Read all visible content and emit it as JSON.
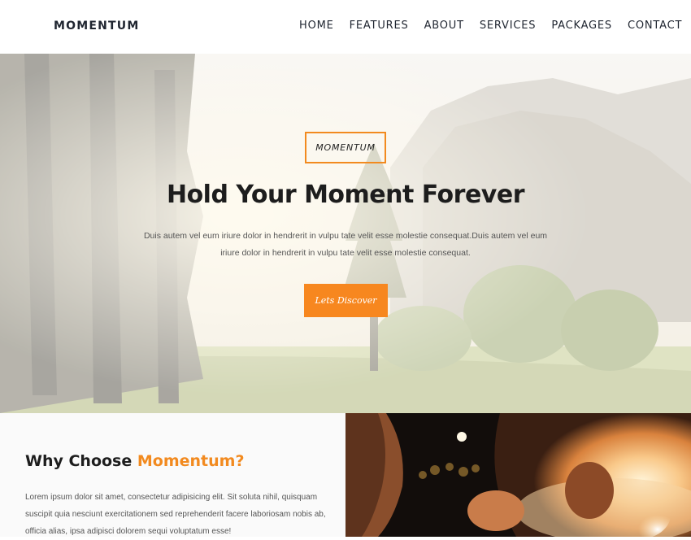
{
  "header": {
    "logo": "MOMENTUM",
    "nav": [
      "HOME",
      "FEATURES",
      "ABOUT",
      "SERVICES",
      "PACKAGES",
      "CONTACT"
    ]
  },
  "hero": {
    "badge": "MOMENTUM",
    "title": "Hold Your Moment Forever",
    "text": "Duis autem vel eum iriure dolor in hendrerit in vulpu tate velit esse molestie consequat.Duis autem vel eum iriure dolor in hendrerit in vulpu tate velit esse molestie consequat.",
    "button": "Lets Discover"
  },
  "why": {
    "title_prefix": "Why Choose ",
    "title_accent": "Momentum?",
    "text": "Lorem ipsum dolor sit amet, consectetur adipisicing elit. Sit soluta nihil, quisquam suscipit quia nesciunt exercitationem sed reprehenderit facere laboriosam nobis ab, officia alias, ipsa adipisci dolorem sequi voluptatum esse!"
  },
  "colors": {
    "accent": "#f7871f",
    "text_dark": "#1d1d1d"
  }
}
